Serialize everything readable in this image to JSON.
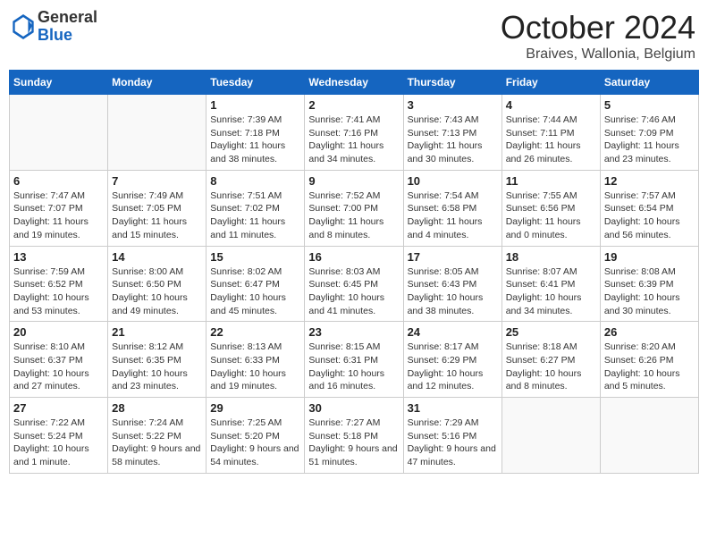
{
  "header": {
    "logo_general": "General",
    "logo_blue": "Blue",
    "month_title": "October 2024",
    "location": "Braives, Wallonia, Belgium"
  },
  "weekdays": [
    "Sunday",
    "Monday",
    "Tuesday",
    "Wednesday",
    "Thursday",
    "Friday",
    "Saturday"
  ],
  "weeks": [
    [
      {
        "day": "",
        "info": ""
      },
      {
        "day": "",
        "info": ""
      },
      {
        "day": "1",
        "info": "Sunrise: 7:39 AM\nSunset: 7:18 PM\nDaylight: 11 hours and 38 minutes."
      },
      {
        "day": "2",
        "info": "Sunrise: 7:41 AM\nSunset: 7:16 PM\nDaylight: 11 hours and 34 minutes."
      },
      {
        "day": "3",
        "info": "Sunrise: 7:43 AM\nSunset: 7:13 PM\nDaylight: 11 hours and 30 minutes."
      },
      {
        "day": "4",
        "info": "Sunrise: 7:44 AM\nSunset: 7:11 PM\nDaylight: 11 hours and 26 minutes."
      },
      {
        "day": "5",
        "info": "Sunrise: 7:46 AM\nSunset: 7:09 PM\nDaylight: 11 hours and 23 minutes."
      }
    ],
    [
      {
        "day": "6",
        "info": "Sunrise: 7:47 AM\nSunset: 7:07 PM\nDaylight: 11 hours and 19 minutes."
      },
      {
        "day": "7",
        "info": "Sunrise: 7:49 AM\nSunset: 7:05 PM\nDaylight: 11 hours and 15 minutes."
      },
      {
        "day": "8",
        "info": "Sunrise: 7:51 AM\nSunset: 7:02 PM\nDaylight: 11 hours and 11 minutes."
      },
      {
        "day": "9",
        "info": "Sunrise: 7:52 AM\nSunset: 7:00 PM\nDaylight: 11 hours and 8 minutes."
      },
      {
        "day": "10",
        "info": "Sunrise: 7:54 AM\nSunset: 6:58 PM\nDaylight: 11 hours and 4 minutes."
      },
      {
        "day": "11",
        "info": "Sunrise: 7:55 AM\nSunset: 6:56 PM\nDaylight: 11 hours and 0 minutes."
      },
      {
        "day": "12",
        "info": "Sunrise: 7:57 AM\nSunset: 6:54 PM\nDaylight: 10 hours and 56 minutes."
      }
    ],
    [
      {
        "day": "13",
        "info": "Sunrise: 7:59 AM\nSunset: 6:52 PM\nDaylight: 10 hours and 53 minutes."
      },
      {
        "day": "14",
        "info": "Sunrise: 8:00 AM\nSunset: 6:50 PM\nDaylight: 10 hours and 49 minutes."
      },
      {
        "day": "15",
        "info": "Sunrise: 8:02 AM\nSunset: 6:47 PM\nDaylight: 10 hours and 45 minutes."
      },
      {
        "day": "16",
        "info": "Sunrise: 8:03 AM\nSunset: 6:45 PM\nDaylight: 10 hours and 41 minutes."
      },
      {
        "day": "17",
        "info": "Sunrise: 8:05 AM\nSunset: 6:43 PM\nDaylight: 10 hours and 38 minutes."
      },
      {
        "day": "18",
        "info": "Sunrise: 8:07 AM\nSunset: 6:41 PM\nDaylight: 10 hours and 34 minutes."
      },
      {
        "day": "19",
        "info": "Sunrise: 8:08 AM\nSunset: 6:39 PM\nDaylight: 10 hours and 30 minutes."
      }
    ],
    [
      {
        "day": "20",
        "info": "Sunrise: 8:10 AM\nSunset: 6:37 PM\nDaylight: 10 hours and 27 minutes."
      },
      {
        "day": "21",
        "info": "Sunrise: 8:12 AM\nSunset: 6:35 PM\nDaylight: 10 hours and 23 minutes."
      },
      {
        "day": "22",
        "info": "Sunrise: 8:13 AM\nSunset: 6:33 PM\nDaylight: 10 hours and 19 minutes."
      },
      {
        "day": "23",
        "info": "Sunrise: 8:15 AM\nSunset: 6:31 PM\nDaylight: 10 hours and 16 minutes."
      },
      {
        "day": "24",
        "info": "Sunrise: 8:17 AM\nSunset: 6:29 PM\nDaylight: 10 hours and 12 minutes."
      },
      {
        "day": "25",
        "info": "Sunrise: 8:18 AM\nSunset: 6:27 PM\nDaylight: 10 hours and 8 minutes."
      },
      {
        "day": "26",
        "info": "Sunrise: 8:20 AM\nSunset: 6:26 PM\nDaylight: 10 hours and 5 minutes."
      }
    ],
    [
      {
        "day": "27",
        "info": "Sunrise: 7:22 AM\nSunset: 5:24 PM\nDaylight: 10 hours and 1 minute."
      },
      {
        "day": "28",
        "info": "Sunrise: 7:24 AM\nSunset: 5:22 PM\nDaylight: 9 hours and 58 minutes."
      },
      {
        "day": "29",
        "info": "Sunrise: 7:25 AM\nSunset: 5:20 PM\nDaylight: 9 hours and 54 minutes."
      },
      {
        "day": "30",
        "info": "Sunrise: 7:27 AM\nSunset: 5:18 PM\nDaylight: 9 hours and 51 minutes."
      },
      {
        "day": "31",
        "info": "Sunrise: 7:29 AM\nSunset: 5:16 PM\nDaylight: 9 hours and 47 minutes."
      },
      {
        "day": "",
        "info": ""
      },
      {
        "day": "",
        "info": ""
      }
    ]
  ]
}
